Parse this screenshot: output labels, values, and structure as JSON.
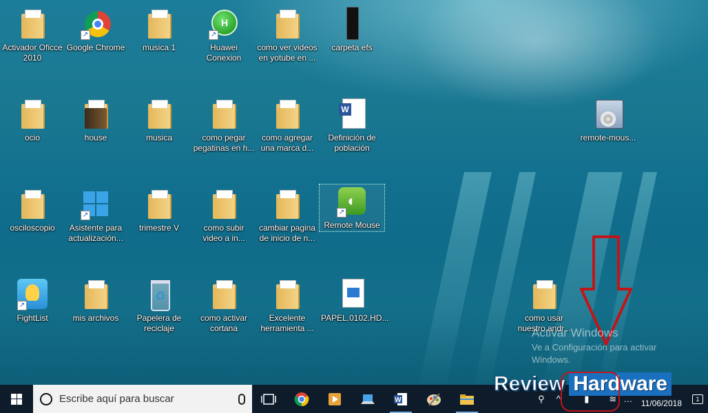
{
  "desktop": {
    "icons": [
      {
        "label": "Activador Oficce 2010",
        "kind": "folder"
      },
      {
        "label": "Google Chrome",
        "kind": "chrome"
      },
      {
        "label": "musica 1",
        "kind": "folder"
      },
      {
        "label": "Huawei Conexion",
        "kind": "huawei"
      },
      {
        "label": "como ver videos en yotube en ...",
        "kind": "folder"
      },
      {
        "label": "carpeta efs",
        "kind": "phone"
      },
      {
        "label": "ocio",
        "kind": "folder"
      },
      {
        "label": "house",
        "kind": "folder-dark"
      },
      {
        "label": "musica",
        "kind": "folder"
      },
      {
        "label": "como pegar pegatinas en h...",
        "kind": "folder"
      },
      {
        "label": "como agregar una marca d...",
        "kind": "folder"
      },
      {
        "label": "Definición de población",
        "kind": "word"
      },
      {
        "label": "remote-mous...",
        "kind": "installer"
      },
      {
        "label": "osciloscopio",
        "kind": "folder"
      },
      {
        "label": "Asistente para actualización...",
        "kind": "windows"
      },
      {
        "label": "trimestre V",
        "kind": "folder"
      },
      {
        "label": "como subir video a in...",
        "kind": "folder"
      },
      {
        "label": "cambiar pagina de inicio de n...",
        "kind": "folder"
      },
      {
        "label": "Remote Mouse",
        "kind": "remote-mouse"
      },
      {
        "label": "FightList",
        "kind": "bulb"
      },
      {
        "label": "mis archivos",
        "kind": "folder"
      },
      {
        "label": "Papelera de reciclaje",
        "kind": "recycle-bin"
      },
      {
        "label": "como activar cortana",
        "kind": "folder"
      },
      {
        "label": "Excelente herramienta ...",
        "kind": "folder"
      },
      {
        "label": "PAPEL.0102.HD...",
        "kind": "video"
      },
      {
        "label": "como usar nuestro andr...",
        "kind": "folder"
      }
    ],
    "watermark": {
      "title": "Activar Windows",
      "subtitle": "Ve a Configuración para activar Windows."
    },
    "overlay": {
      "brand_word_1": "Review",
      "brand_word_2": "Hardware",
      "arrow_color": "#c0161a"
    }
  },
  "taskbar": {
    "search_placeholder": "Escribe aquí para buscar",
    "pinned": [
      "task-view-icon",
      "chrome-icon",
      "media-player-icon",
      "laptop-icon",
      "word-icon",
      "paint-icon",
      "file-explorer-icon"
    ],
    "tray": {
      "date": "11/06/2018",
      "notification_count": "1"
    }
  }
}
